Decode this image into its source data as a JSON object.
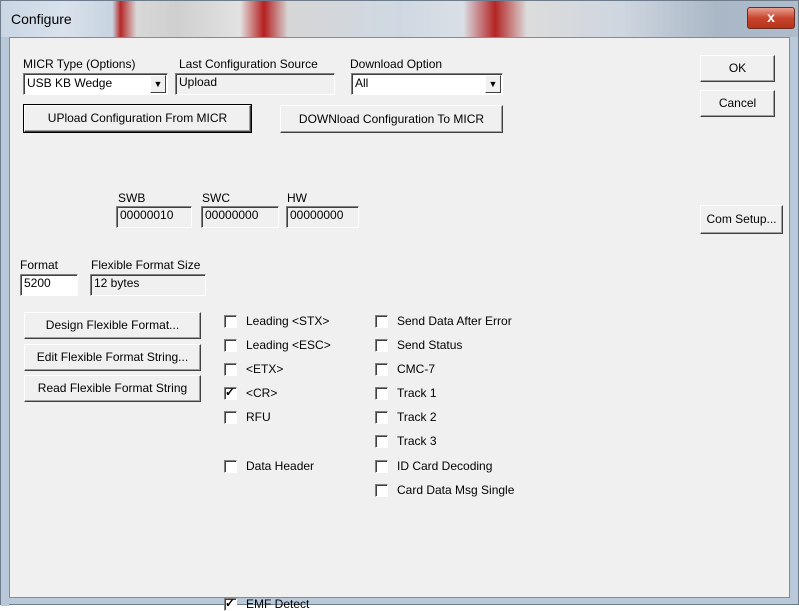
{
  "window": {
    "title": "Configure",
    "close_glyph": "x"
  },
  "top": {
    "micr_type": {
      "label": "MICR Type (Options)",
      "value": "USB KB Wedge"
    },
    "last_source": {
      "label": "Last Configuration Source",
      "value": "Upload"
    },
    "download_option": {
      "label": "Download Option",
      "value": "All"
    },
    "upload_button": "UPload Configuration From MICR",
    "download_button": "DOWNload Configuration To MICR"
  },
  "side_buttons": {
    "ok": "OK",
    "cancel": "Cancel",
    "com_setup": "Com Setup..."
  },
  "versions": {
    "swb": {
      "label": "SWB",
      "value": "00000010"
    },
    "swc": {
      "label": "SWC",
      "value": "00000000"
    },
    "hw": {
      "label": "HW",
      "value": "00000000"
    }
  },
  "format": {
    "format_label": "Format",
    "format_value": "5200",
    "size_label": "Flexible Format Size",
    "size_value": "12 bytes"
  },
  "format_buttons": {
    "design": "Design Flexible Format...",
    "edit": "Edit Flexible Format String...",
    "read": "Read Flexible Format String"
  },
  "options_left": [
    {
      "label": "Leading <STX>",
      "checked": false
    },
    {
      "label": "Leading <ESC>",
      "checked": false
    },
    {
      "label": "<ETX>",
      "checked": false
    },
    {
      "label": "<CR>",
      "checked": true
    },
    {
      "label": "RFU",
      "checked": false
    }
  ],
  "data_header": {
    "label": "Data Header",
    "checked": false
  },
  "options_right": [
    {
      "label": "Send Data After Error",
      "checked": false
    },
    {
      "label": "Send Status",
      "checked": false
    },
    {
      "label": "CMC-7",
      "checked": false
    },
    {
      "label": "Track 1",
      "checked": false
    },
    {
      "label": "Track 2",
      "checked": false
    },
    {
      "label": "Track 3",
      "checked": false
    },
    {
      "label": "ID Card Decoding",
      "checked": false
    },
    {
      "label": "Card Data Msg Single",
      "checked": false
    }
  ],
  "emf_detect": {
    "label": "EMF Detect",
    "checked": true
  },
  "check_glyph": "✓",
  "dropdown_glyph": "▼"
}
